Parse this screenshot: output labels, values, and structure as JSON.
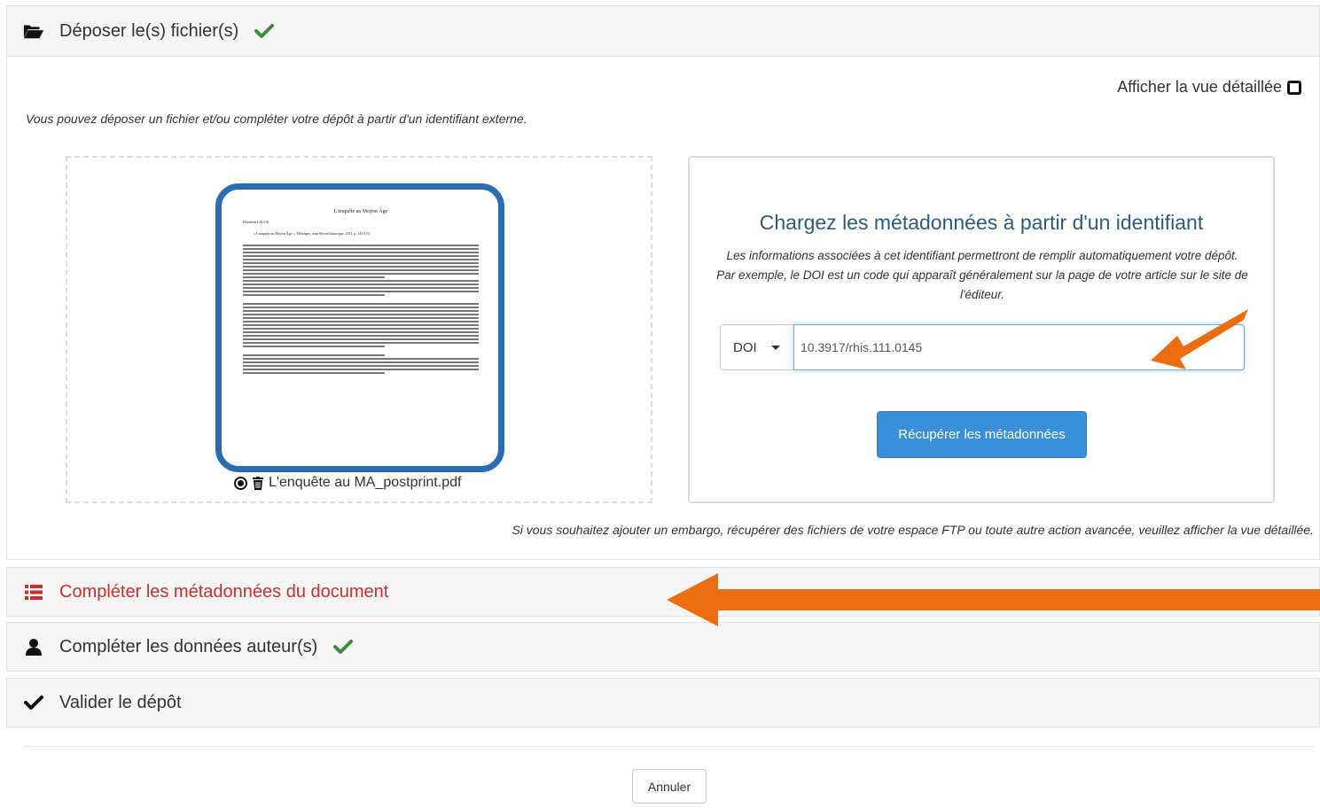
{
  "deposit": {
    "title": "Déposer le(s) fichier(s)",
    "detail_toggle": "Afficher la vue détaillée",
    "intro": "Vous pouvez déposer un fichier et/ou compléter votre dépôt à partir d'un identifiant externe.",
    "file": {
      "name": "L'enquête au MA_postprint.pdf",
      "preview_title": "L'enquête au Moyen Âge",
      "preview_author": "Elisabeth LALOU",
      "preview_ref": "« L'enquête au Moyen Âge », Mélanges, dans Revue historique, 2011, p. 145-153."
    },
    "identifier": {
      "title": "Chargez les métadonnées à partir d'un identifiant",
      "description": "Les informations associées à cet identifiant permettront de remplir automatiquement votre dépôt. Par exemple, le DOI est un code qui apparaît généralement sur la page de votre article sur le site de l'éditeur.",
      "type": "DOI",
      "value": "10.3917/rhis.111.0145",
      "fetch_button": "Récupérer les métadonnées"
    },
    "embargo_note": "Si vous souhaitez ajouter un embargo, récupérer des fichiers de votre espace FTP ou toute autre action avancée, veuillez",
    "embargo_link": "afficher la vue détaillée."
  },
  "sections": {
    "metadata": "Compléter les métadonnées du document",
    "authors": "Compléter les données auteur(s)",
    "validate": "Valider le dépôt"
  },
  "footer": {
    "cancel": "Annuler"
  },
  "colors": {
    "accent_orange": "#ec6d0f",
    "check_green": "#3c8d3c",
    "alert_red": "#c9302c",
    "link_blue": "#2b5b84",
    "button_blue": "#3a8fd9",
    "thumb_border": "#2a6db0"
  }
}
